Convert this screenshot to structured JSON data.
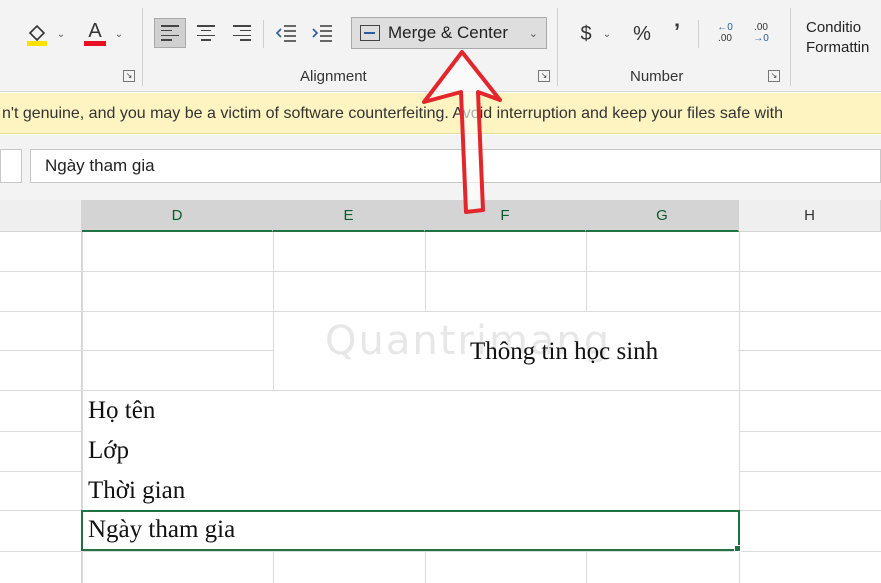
{
  "ribbon": {
    "fill_color_icon": "fill-color-icon",
    "font_color_letter": "A",
    "merge_label": "Merge & Center",
    "currency_symbol": "$",
    "percent_symbol": "%",
    "comma_symbol": "’",
    "inc_decimal": ".00",
    "dec_decimal": ".0",
    "conditional_line1": "Conditio",
    "conditional_line2": "Formattin",
    "groups": {
      "alignment": "Alignment",
      "number": "Number"
    },
    "colors": {
      "fill_yellow": "#ffe100",
      "font_red": "#e81123",
      "accent_green": "#217346"
    }
  },
  "warning": {
    "text": "n't genuine, and you may be a victim of software counterfeiting. Avoid interruption and keep your files safe with"
  },
  "formula_bar": {
    "value": "Ngày tham gia"
  },
  "grid": {
    "columns": [
      "D",
      "E",
      "F",
      "G",
      "H"
    ],
    "selected_columns": [
      "D",
      "E",
      "F",
      "G"
    ],
    "cells": {
      "title": "Thông tin học sinh",
      "ho_ten": "Họ tên",
      "lop": "Lớp",
      "thoi_gian": "Thời gian",
      "ngay_tham_gia": "Ngày tham gia"
    }
  },
  "watermark": "Quantrimang"
}
